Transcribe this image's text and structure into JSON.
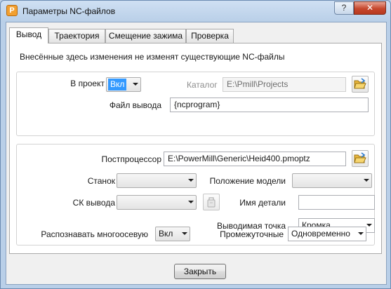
{
  "window": {
    "title": "Параметры NC-файлов",
    "help_glyph": "?",
    "close_glyph": "✕"
  },
  "tabs": [
    {
      "label": "Вывод",
      "active": true
    },
    {
      "label": "Траектория",
      "active": false
    },
    {
      "label": "Смещение зажима",
      "active": false
    },
    {
      "label": "Проверка",
      "active": false
    }
  ],
  "notice": "Внесённые здесь изменения не изменят существующие NC-файлы",
  "project": {
    "label": "В проект",
    "value": "Вкл",
    "catalog_label": "Каталог",
    "catalog_value": "E:\\Pmill\\Projects",
    "output_file_label": "Файл вывода",
    "output_file_value": "{ncprogram}"
  },
  "post": {
    "postprocessor_label": "Постпроцессор",
    "postprocessor_value": "E:\\PowerMill\\Generic\\Heid400.pmoptz",
    "machine_label": "Станок",
    "machine_value": "",
    "model_position_label": "Положение модели",
    "model_position_value": "",
    "output_cs_label": "СК вывода",
    "output_cs_value": "",
    "part_name_label": "Имя детали",
    "part_name_value": "",
    "output_point_label": "Выводимая точка",
    "output_point_value": "Кромка",
    "multiaxis_label": "Распознавать многоосевую",
    "multiaxis_value": "Вкл",
    "intermediate_label": "Промежуточные",
    "intermediate_value": "Одновременно"
  },
  "buttons": {
    "close_label": "Закрыть"
  },
  "icons": {
    "folder": "folder-open-icon",
    "workplane": "workplane-icon",
    "app": "powermill-app-icon"
  },
  "colors": {
    "selection": "#3399ff",
    "close_button": "#c6472d"
  }
}
